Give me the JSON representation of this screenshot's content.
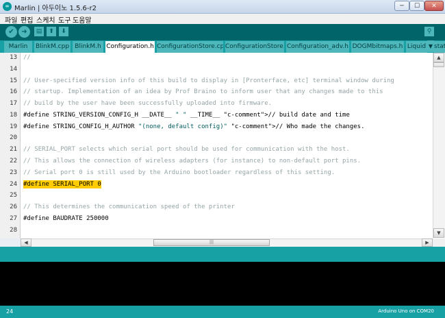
{
  "window": {
    "title": "Marlin | 아두이노 1.5.6-r2",
    "app_icon_text": "∞",
    "min_label": "─",
    "max_label": "☐",
    "close_label": "✕"
  },
  "menu": [
    "파일",
    "편집",
    "스케치",
    "도구",
    "도움말"
  ],
  "toolbar": {
    "verify_icon": "✔",
    "upload_icon": "➜",
    "new_icon": "▤",
    "open_icon": "⬆",
    "save_icon": "⬇",
    "serial_monitor_icon": "⚲"
  },
  "tabs": [
    "Marlin",
    "BlinkM.cpp",
    "BlinkM.h",
    "Configuration.h",
    "ConfigurationStore.cpp",
    "ConfigurationStore.h",
    "Configuration_adv.h",
    "DOGMbitmaps.h",
    "Liquid",
    "stat"
  ],
  "active_tab": "Configuration.h",
  "tab_menu_icon": "▼",
  "editor": {
    "lines": [
      {
        "no": "13",
        "code": "//"
      },
      {
        "no": "14",
        "code": ""
      },
      {
        "no": "15",
        "code": "// User-specified version info of this build to display in [Pronterface, etc] terminal window during"
      },
      {
        "no": "16",
        "code": "// startup. Implementation of an idea by Prof Braino to inform user that any changes made to this"
      },
      {
        "no": "17",
        "code": "// build by the user have been successfully uploaded into firmware."
      },
      {
        "no": "18",
        "code": "#define STRING_VERSION_CONFIG_H __DATE__ \" \" __TIME__ // build date and time"
      },
      {
        "no": "19",
        "code": "#define STRING_CONFIG_H_AUTHOR \"(none, default config)\" // Who made the changes."
      },
      {
        "no": "20",
        "code": ""
      },
      {
        "no": "21",
        "code": "// SERIAL_PORT selects which serial port should be used for communication with the host."
      },
      {
        "no": "22",
        "code": "// This allows the connection of wireless adapters (for instance) to non-default port pins."
      },
      {
        "no": "23",
        "code": "// Serial port 0 is still used by the Arduino bootloader regardless of this setting."
      },
      {
        "no": "24",
        "code": "#define SERIAL_PORT 0"
      },
      {
        "no": "25",
        "code": ""
      },
      {
        "no": "26",
        "code": "// This determines the communication speed of the printer"
      },
      {
        "no": "27",
        "code": "#define BAUDRATE 250000"
      },
      {
        "no": "28",
        "code": ""
      }
    ]
  },
  "scroll": {
    "up_icon": "▲",
    "down_icon": "▼",
    "left_icon": "◀",
    "right_icon": "▶",
    "thumb_grip": "|||"
  },
  "status": {
    "line_number": "24",
    "board": "Arduino Uno on COM20"
  },
  "colors": {
    "teal_dark": "#006468",
    "teal": "#17a1a5",
    "teal_light": "#4db7bb",
    "highlight": "#ffcc00"
  }
}
